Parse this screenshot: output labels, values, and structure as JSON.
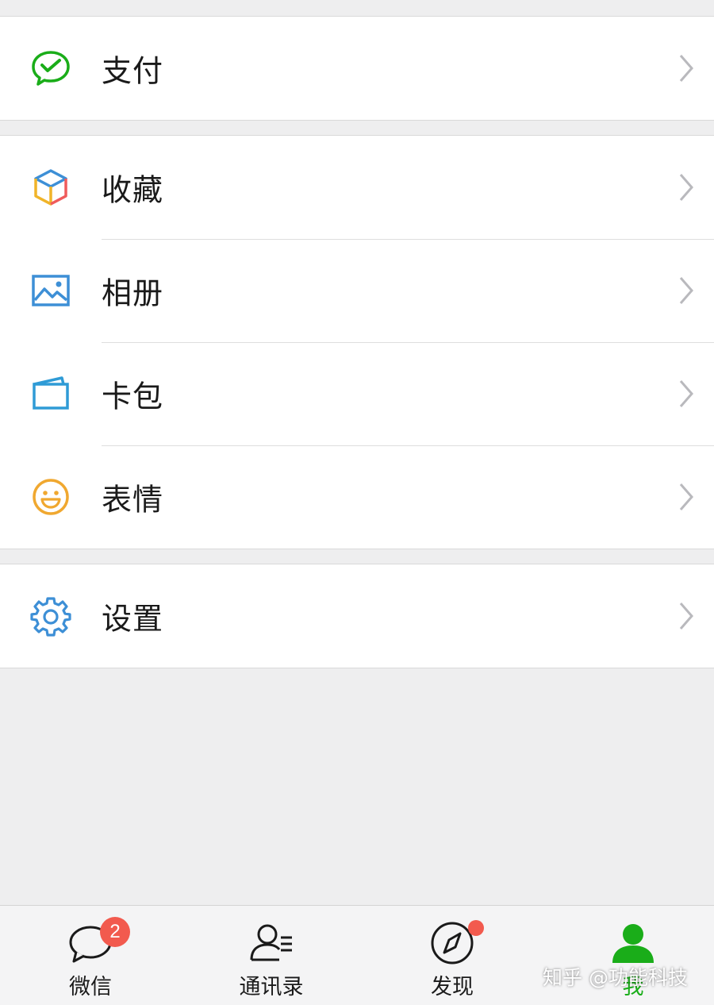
{
  "menu": {
    "pay": "支付",
    "favorites": "收藏",
    "album": "相册",
    "cards": "卡包",
    "stickers": "表情",
    "settings": "设置"
  },
  "tabbar": {
    "chats": "微信",
    "chats_badge": "2",
    "contacts": "通讯录",
    "discover": "发现",
    "me": "我"
  },
  "watermark": "知乎 @功能科技",
  "colors": {
    "accent": "#1aad19",
    "badge": "#f25a4e",
    "background": "#eeeeef"
  },
  "icons": {
    "pay": "wechat-pay-icon",
    "favorites": "cube-icon",
    "album": "picture-icon",
    "cards": "wallet-card-icon",
    "stickers": "smiley-icon",
    "settings": "gear-icon"
  }
}
